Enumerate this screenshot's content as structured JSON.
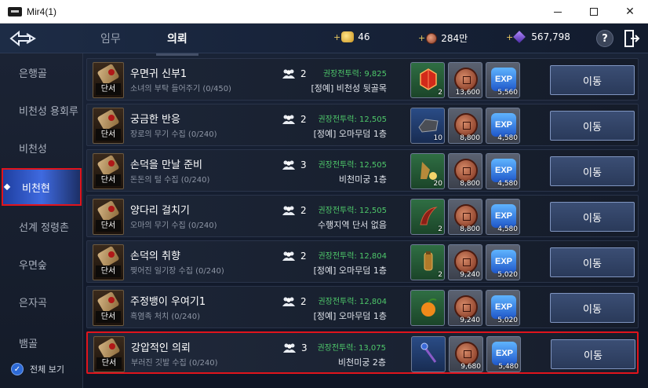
{
  "window": {
    "title": "Mir4(1)",
    "min_glyph": "",
    "max_glyph": "",
    "close_glyph": "✕"
  },
  "header": {
    "tabs": [
      {
        "label": "임무"
      },
      {
        "label": "의뢰"
      }
    ],
    "currencies": [
      {
        "name": "gold",
        "value": "46"
      },
      {
        "name": "copper",
        "value": "284만"
      },
      {
        "name": "dark-steel",
        "value": "567,798"
      }
    ],
    "help_label": "?"
  },
  "sidebar": {
    "items": [
      {
        "label": "은행골"
      },
      {
        "label": "비천성 용회루"
      },
      {
        "label": "비천성"
      },
      {
        "label": "비천현"
      },
      {
        "label": "선계 정령촌"
      },
      {
        "label": "우면숲"
      },
      {
        "label": "은자곡"
      },
      {
        "label": "뱀골"
      }
    ],
    "active_index": 3,
    "show_all_label": "전체 보기"
  },
  "requests": [
    {
      "badge": "단서",
      "title": "우면귀 신부1",
      "sub": "소녀의 부탁 들어주기 (0/450)",
      "party": "2",
      "power": "권장전투력: 9,825",
      "location": "[정예] 비천성 뒷골목",
      "item_qty": "2",
      "copper": "13,600",
      "exp": "5,560",
      "item_icon": "red-crystal-icon",
      "button": "이동"
    },
    {
      "badge": "단서",
      "title": "궁금한 반응",
      "sub": "장로의 무기 수집 (0/240)",
      "party": "2",
      "power": "권장전투력: 12,505",
      "location": "[정예] 오마무덤 1층",
      "item_qty": "10",
      "copper": "8,800",
      "exp": "4,580",
      "item_icon": "ore-icon",
      "button": "이동"
    },
    {
      "badge": "단서",
      "title": "손덕을 만날 준비",
      "sub": "돈돈의 털 수집 (0/240)",
      "party": "3",
      "power": "권장전투력: 12,505",
      "location": "비천미궁 1층",
      "item_qty": "20",
      "copper": "8,800",
      "exp": "4,580",
      "item_icon": "potion-icon",
      "button": "이동"
    },
    {
      "badge": "단서",
      "title": "양다리 걸치기",
      "sub": "오마의 무기 수집 (0/240)",
      "party": "2",
      "power": "권장전투력: 12,505",
      "location": "수행지역 단서 없음",
      "item_qty": "2",
      "copper": "8,800",
      "exp": "4,580",
      "item_icon": "horn-icon",
      "button": "이동"
    },
    {
      "badge": "단서",
      "title": "손덕의 취향",
      "sub": "찢어진 일기장 수집 (0/240)",
      "party": "2",
      "power": "권장전투력: 12,804",
      "location": "[정예] 오마무덤 1층",
      "item_qty": "2",
      "copper": "9,240",
      "exp": "5,020",
      "item_icon": "jar-icon",
      "button": "이동"
    },
    {
      "badge": "단서",
      "title": "주정뱅이 우여기1",
      "sub": "흑염족 처치 (0/240)",
      "party": "2",
      "power": "권장전투력: 12,804",
      "location": "[정예] 오마무덤 1층",
      "item_qty": "",
      "copper": "9,240",
      "exp": "5,020",
      "item_icon": "fruit-icon",
      "button": "이동"
    },
    {
      "badge": "단서",
      "title": "강압적인 의뢰",
      "sub": "부러진 깃발 수집 (0/240)",
      "party": "3",
      "power": "권장전투력: 13,075",
      "location": "비천미궁 2층",
      "item_qty": "",
      "copper": "9,680",
      "exp": "5,480",
      "item_icon": "staff-icon",
      "button": "이동"
    }
  ],
  "exp_label": "EXP",
  "colors": {
    "power_green": "#4ec86a",
    "highlight_red": "#e0141c",
    "active_blue": "#3f6ae0"
  }
}
